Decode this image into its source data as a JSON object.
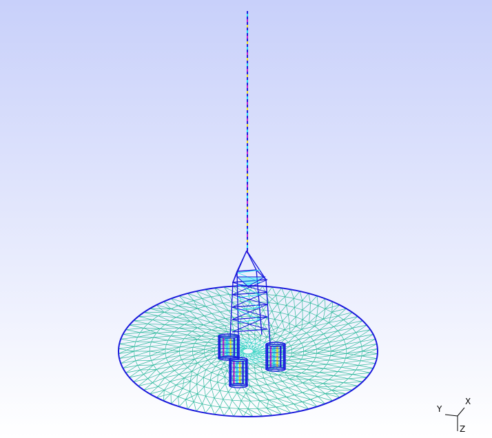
{
  "colors": {
    "background_top": "#c8d0fa",
    "background_bottom": "#ffffff",
    "mesh_edge": "#1a1adc",
    "mesh_line": "#2ab89a",
    "mesh_dense": "#2fd2c0",
    "hotspot_magenta": "#c21ec8",
    "hotspot_yellow": "#f0e020",
    "hotspot_cyan": "#20e0f0",
    "axis_color": "#000000"
  },
  "triad": {
    "x_label": "X",
    "y_label": "Y",
    "z_label": "Z"
  }
}
